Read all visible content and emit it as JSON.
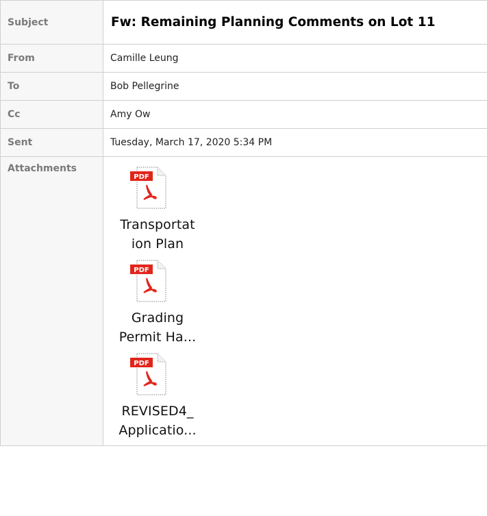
{
  "header": {
    "subject_label": "Subject",
    "subject": "Fw: Remaining Planning Comments on Lot 11",
    "from_label": "From",
    "from": "Camille Leung",
    "to_label": "To",
    "to": "Bob Pellegrine",
    "cc_label": "Cc",
    "cc": "Amy Ow",
    "sent_label": "Sent",
    "sent": "Tuesday, March 17, 2020 5:34 PM",
    "attachments_label": "Attachments"
  },
  "attachments": [
    {
      "icon": "pdf-file-icon",
      "badge": "PDF",
      "line1": "Transportat",
      "line2": "ion Plan"
    },
    {
      "icon": "pdf-file-icon",
      "badge": "PDF",
      "line1": "Grading",
      "line2": "Permit Ha..."
    },
    {
      "icon": "pdf-file-icon",
      "badge": "PDF",
      "line1": "REVISED4_",
      "line2": "Applicatio..."
    }
  ],
  "colors": {
    "pdf_badge": "#e1251b",
    "label_text": "#7a7a7a",
    "label_bg": "#f7f7f7",
    "border": "#cfcfcf"
  }
}
